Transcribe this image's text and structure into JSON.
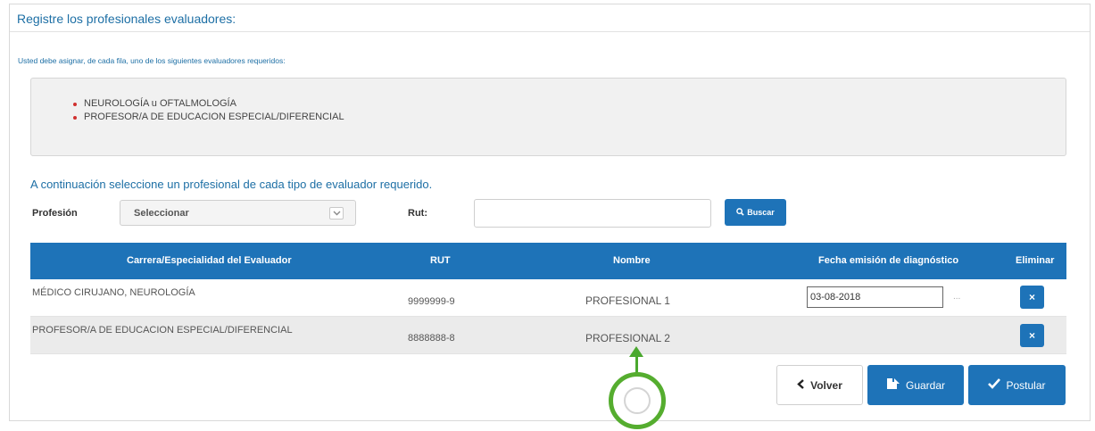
{
  "panel": {
    "title": "Registre los profesionales evaluadores:",
    "instruction": "Usted debe asignar, de cada fila, uno de los siguientes evaluadores requeridos:",
    "requirements": [
      "NEUROLOGÍA u OFTALMOLOGÍA",
      "PROFESOR/A DE EDUCACION ESPECIAL/DIFERENCIAL"
    ],
    "subtitle": "A continuación seleccione un profesional de cada tipo de evaluador requerido."
  },
  "search": {
    "profesion_label": "Profesión",
    "profesion_value": "Seleccionar",
    "rut_label": "Rut:",
    "rut_value": "",
    "buscar_label": "Buscar"
  },
  "table": {
    "headers": [
      "Carrera/Especialidad del Evaluador",
      "RUT",
      "Nombre",
      "Fecha emisión de diagnóstico",
      "Eliminar"
    ],
    "rows": [
      {
        "carrera": "MÉDICO CIRUJANO, NEUROLOGÍA",
        "rut": "9999999-9",
        "nombre": "PROFESIONAL 1",
        "fecha": "03-08-2018",
        "dots": "..."
      },
      {
        "carrera": "PROFESOR/A DE EDUCACION ESPECIAL/DIFERENCIAL",
        "rut": "8888888-8",
        "nombre": "PROFESIONAL 2",
        "fecha": ""
      }
    ],
    "delete_glyph": "×"
  },
  "actions": {
    "volver_label": "Volver",
    "guardar_label": "Guardar",
    "postular_label": "Postular"
  },
  "icons": {
    "chevron_down": "chevron-down-icon",
    "search": "search-icon",
    "chevron_left": "chevron-left-icon",
    "save": "save-icon",
    "check": "check-icon",
    "close": "close-icon"
  },
  "colors": {
    "accent": "#1e73b8",
    "title_blue": "#1d6fa5",
    "bullet_red": "#d0302f",
    "pointer_green": "#55ad2f"
  }
}
